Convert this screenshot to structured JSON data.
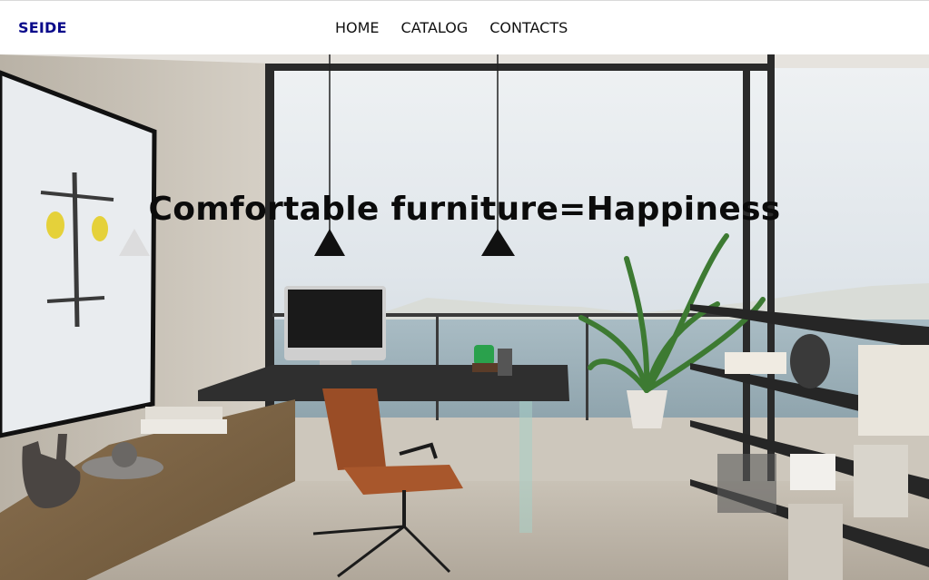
{
  "brand": {
    "name": "SEIDE",
    "color": "#0a0a8a"
  },
  "nav": {
    "items": [
      {
        "label": "HOME"
      },
      {
        "label": "CATALOG"
      },
      {
        "label": "CONTACTS"
      }
    ]
  },
  "hero": {
    "title": "Comfortable furniture=Happiness",
    "image": "modern-home-office-interior"
  }
}
